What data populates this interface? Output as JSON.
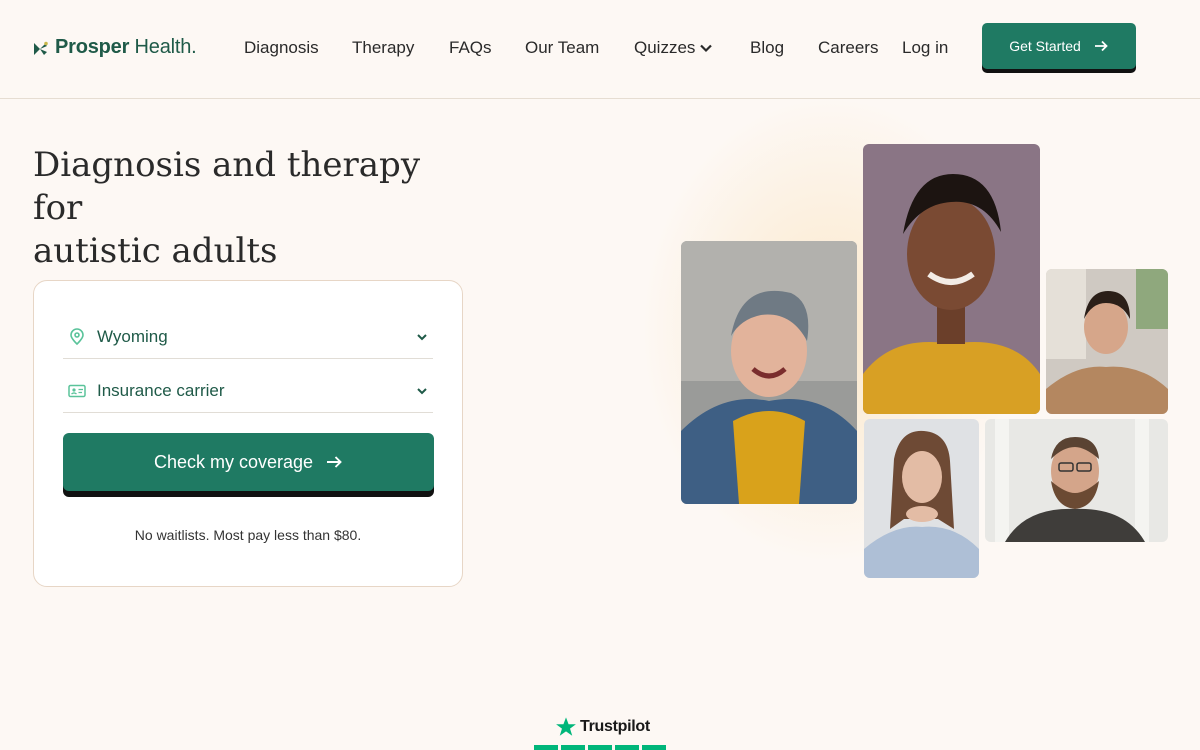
{
  "header": {
    "brand": {
      "icon": "prosper-leaf-logo-icon",
      "name_bold": "Prosper",
      "name_rest": " Health."
    },
    "nav": [
      {
        "label": "Diagnosis"
      },
      {
        "label": "Therapy"
      },
      {
        "label": "FAQs"
      },
      {
        "label": "Our Team"
      },
      {
        "label": "Quizzes",
        "icon": "chevron-down-icon"
      },
      {
        "label": "Blog"
      },
      {
        "label": "Careers"
      },
      {
        "label": "Log in"
      }
    ],
    "cta": {
      "label": "Get Started",
      "icon": "arrow-right-icon"
    }
  },
  "hero": {
    "title_line1": "Diagnosis and therapy for",
    "title_line2": "autistic adults"
  },
  "coverage_form": {
    "state": {
      "value": "Wyoming",
      "icon": "location-pin-icon"
    },
    "insurance": {
      "placeholder": "Insurance carrier",
      "icon": "id-card-icon"
    },
    "submit": {
      "label": "Check my coverage",
      "icon": "arrow-right-icon"
    },
    "note": "No waitlists. Most pay less than $80."
  },
  "trustpilot": {
    "label": "Trustpilot",
    "icon": "star-icon",
    "rating_stars": 5
  },
  "colors": {
    "background": "#fdf8f4",
    "brand_green": "#1f7a63",
    "text_green": "#1f5a48",
    "trustpilot_green": "#00b67a"
  }
}
